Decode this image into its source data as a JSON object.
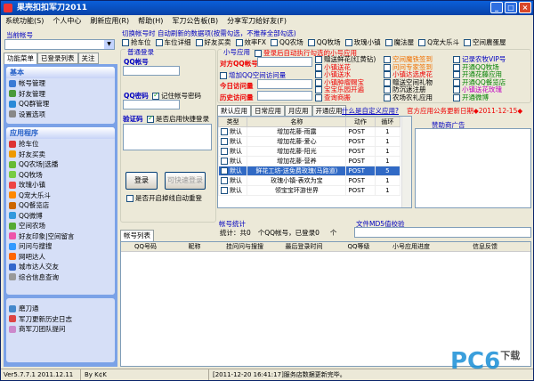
{
  "window": {
    "title": "果壳扣扣军刀2011"
  },
  "menu": [
    "系统功能(S)",
    "个人中心",
    "刷新应用(R)",
    "帮助(H)",
    "军刀公告板(B)",
    "分享军刀给好友(F)"
  ],
  "current_account": {
    "label": "当前帐号"
  },
  "left_tabs": [
    "功能菜单",
    "已登录列表",
    "关注"
  ],
  "basic": {
    "header": "基本",
    "items": [
      "帐号管理",
      "好友管理",
      "QQ群管理",
      "设置选项"
    ]
  },
  "apps": {
    "header": "应用程序",
    "items": [
      "抢车位",
      "好友买卖",
      "QQ农场|选播",
      "QQ牧场",
      "玫瑰小镇",
      "Q宠大乐斗",
      "QQ餐览店",
      "QQ微博",
      "空间农场",
      "好友印象|空间留言",
      "问问与搜搜",
      "网吧达人",
      "城市达人交友",
      "综合信息查询"
    ]
  },
  "tools": {
    "items": [
      "磨刀通",
      "军刀更新历史日志",
      "商军刀团队提问"
    ]
  },
  "top_checks": {
    "caption": "切换帐号时 自动刷新的数据项(按需勾选，不推荐全部勾选)",
    "items": [
      "抢车位",
      "车位详细",
      "好友买卖",
      "效率FX",
      "QQ农场",
      "QQ牧场",
      "玫瑰小镇",
      "魔法屋",
      "Q宠大乐斗",
      "空间農蛋屋"
    ]
  },
  "login": {
    "group": "普通登录",
    "account_label": "QQ帐号",
    "password_label": "QQ密码",
    "remember_label": "记住帐号密码",
    "captcha_label": "验证码",
    "quick_login_label": "是否启用快捷登录",
    "login_button": "登录",
    "quick_button": "可快速登录",
    "auto_login_label": "是否开启掉线自动重登"
  },
  "mini": {
    "group": "小号应用",
    "auto_label": "登录后自动执行勾选的小号应用",
    "target_label": "对方QQ帐号",
    "increase_label": "增加QQ空间访问量",
    "today_label": "今日访问量",
    "history_label": "历史访问量"
  },
  "options": {
    "col1": [
      "赠送鲜花(红黄钻)",
      "小镇送花",
      "小镇送水",
      "小镇肿瘤赐宝",
      "宝宝乐园开遍",
      "查询商搬"
    ],
    "col2": [
      "空间魔铁签到",
      "问问专家签到",
      "小镇达选虎花",
      "赠送空间礼物",
      "防沉迷注册",
      "农场农礼应用"
    ],
    "col3": [
      "记录农牧VIP号",
      "开通QQ牧场",
      "开通花藤应用",
      "开通QQ餐览店",
      "小镇送花玫瑰",
      "开通微博"
    ]
  },
  "app_tabs": [
    "默认应用",
    "日常应用",
    "月应用",
    "开通应用"
  ],
  "custom_link": "什么是自定义应用?",
  "notice_link": "官方应用公务更新日期◆2011-12-15◆",
  "sponsor_label": "赞助商广告",
  "app_table": {
    "headers": [
      "类型",
      "名称",
      "动作",
      "循环"
    ],
    "rows": [
      [
        "默认",
        "增加花藤-雨露",
        "POST",
        "1"
      ],
      [
        "默认",
        "增加花藤-爱心",
        "POST",
        "1"
      ],
      [
        "默认",
        "增加花藤-阳光",
        "POST",
        "1"
      ],
      [
        "默认",
        "增加花藤-营养",
        "POST",
        "1"
      ],
      [
        "默认",
        "鲜花工坊-送免费玫瑰(马路道)",
        "POST",
        "5"
      ],
      [
        "默认",
        "玫瑰小镇-表欢为宝",
        "POST",
        "1"
      ],
      [
        "默认",
        "领宝宝环游世界",
        "POST",
        "1"
      ]
    ],
    "selected_row": 4
  },
  "stats": {
    "label": "帐号统计",
    "text": "统计：共",
    "count": "0",
    "mid": "个QQ帐号，已登录",
    "logged": "0",
    "unit": "个"
  },
  "md5": {
    "label": "文件MD5值校验"
  },
  "account_tab": "帐号列表",
  "account_table": {
    "headers": [
      "QQ号码",
      "昵称",
      "挂问问与搜搜",
      "最后登录时间",
      "QQ等级",
      "小号应用进度",
      "信息反馈"
    ]
  },
  "status": {
    "version": "Ver5.7.7.1 2011.12.11",
    "author": "By K¢K",
    "message": "[2011-12-20 16:41:17]服务店数据更新完毕。"
  },
  "watermark": {
    "text": "PC6",
    "sub": "下载"
  }
}
